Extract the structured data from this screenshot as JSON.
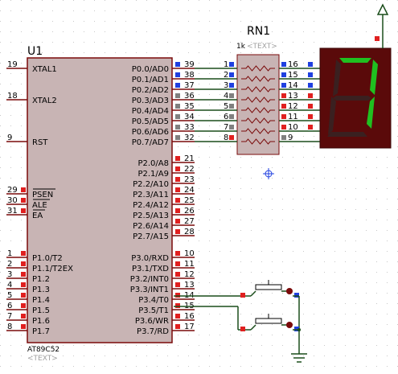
{
  "colors": {
    "background": "#ffffff",
    "grid_dot": "#c8c8c8",
    "chip_body": "#c8b4b4",
    "chip_border": "#7a0a0a",
    "wire": "#1a4d1a",
    "pin": "#7a0a0a",
    "pin_marker_red": "#e02020",
    "pin_marker_blue": "#2040e0",
    "pin_marker_grey": "#808080",
    "display_body": "#5a0a0a",
    "segment_on": "#20c020",
    "segment_off": "#3a2020",
    "probe": "#2040e0"
  },
  "u1": {
    "ref": "U1",
    "part": "AT89C52",
    "text_placeholder": "<TEXT>",
    "left_pins": [
      {
        "num": "19",
        "name": "XTAL1"
      },
      {
        "num": "18",
        "name": "XTAL2"
      },
      {
        "num": "9",
        "name": "RST"
      },
      {
        "num": "29",
        "name": "PSEN"
      },
      {
        "num": "30",
        "name": "ALE"
      },
      {
        "num": "31",
        "name": "EA"
      },
      {
        "num": "1",
        "name": "P1.0/T2"
      },
      {
        "num": "2",
        "name": "P1.1/T2EX"
      },
      {
        "num": "3",
        "name": "P1.2"
      },
      {
        "num": "4",
        "name": "P1.3"
      },
      {
        "num": "5",
        "name": "P1.4"
      },
      {
        "num": "6",
        "name": "P1.5"
      },
      {
        "num": "7",
        "name": "P1.6"
      },
      {
        "num": "8",
        "name": "P1.7"
      }
    ],
    "right_pins": [
      {
        "num": "39",
        "name": "P0.0/AD0"
      },
      {
        "num": "38",
        "name": "P0.1/AD1"
      },
      {
        "num": "37",
        "name": "P0.2/AD2"
      },
      {
        "num": "36",
        "name": "P0.3/AD3"
      },
      {
        "num": "35",
        "name": "P0.4/AD4"
      },
      {
        "num": "34",
        "name": "P0.5/AD5"
      },
      {
        "num": "33",
        "name": "P0.6/AD6"
      },
      {
        "num": "32",
        "name": "P0.7/AD7"
      },
      {
        "num": "21",
        "name": "P2.0/A8"
      },
      {
        "num": "22",
        "name": "P2.1/A9"
      },
      {
        "num": "23",
        "name": "P2.2/A10"
      },
      {
        "num": "24",
        "name": "P2.3/A11"
      },
      {
        "num": "25",
        "name": "P2.4/A12"
      },
      {
        "num": "26",
        "name": "P2.5/A13"
      },
      {
        "num": "27",
        "name": "P2.6/A14"
      },
      {
        "num": "28",
        "name": "P2.7/A15"
      },
      {
        "num": "10",
        "name": "P3.0/RXD"
      },
      {
        "num": "11",
        "name": "P3.1/TXD"
      },
      {
        "num": "12",
        "name": "P3.2/INT0"
      },
      {
        "num": "13",
        "name": "P3.3/INT1"
      },
      {
        "num": "14",
        "name": "P3.4/T0"
      },
      {
        "num": "15",
        "name": "P3.5/T1"
      },
      {
        "num": "16",
        "name": "P3.6/WR"
      },
      {
        "num": "17",
        "name": "P3.7/RD"
      }
    ]
  },
  "rn1": {
    "ref": "RN1",
    "value": "1k",
    "text_placeholder": "<TEXT>",
    "left_pins": [
      "1",
      "2",
      "3",
      "4",
      "5",
      "6",
      "7",
      "8"
    ],
    "right_pins": [
      "16",
      "15",
      "14",
      "13",
      "12",
      "11",
      "10",
      "9"
    ]
  },
  "display": {
    "digit": "7"
  }
}
